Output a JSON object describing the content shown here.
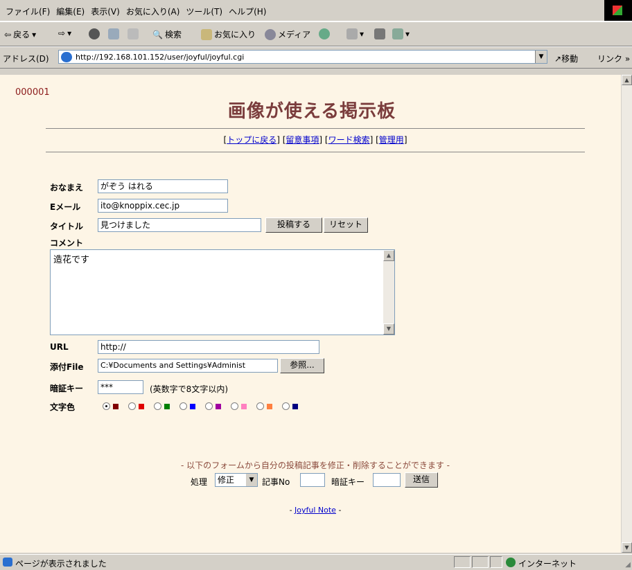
{
  "menu": [
    "ファイル(F)",
    "編集(E)",
    "表示(V)",
    "お気に入り(A)",
    "ツール(T)",
    "ヘルプ(H)"
  ],
  "toolbar": {
    "back": "戻る",
    "search": "検索",
    "favorites": "お気に入り",
    "media": "メディア"
  },
  "address": {
    "label": "アドレス(D)",
    "url": "http://192.168.101.152/user/joyful/joyful.cgi",
    "go": "移動",
    "links": "リンク »"
  },
  "page": {
    "counter": "000001",
    "title": "画像が使える掲示板",
    "nav": [
      {
        "label": "トップに戻る"
      },
      {
        "label": "留意事項"
      },
      {
        "label": "ワード検索"
      },
      {
        "label": "管理用"
      }
    ]
  },
  "form": {
    "name_label": "おなまえ",
    "name_value": "がぞう はれる",
    "email_label": "Eメール",
    "email_value": "ito@knoppix.cec.jp",
    "title_label": "タイトル",
    "title_value": "見つけました",
    "submit_label": "投稿する",
    "reset_label": "リセット",
    "comment_label": "コメント",
    "comment_value": "造花です",
    "url_label": "URL",
    "url_value": "http://",
    "file_label": "添付File",
    "file_value": "C:¥Documents and Settings¥Administ",
    "browse_label": "参照...",
    "key_label": "暗証キー",
    "key_value": "***",
    "key_note": "(英数字で8文字以内)",
    "color_label": "文字色",
    "colors": [
      "#800000",
      "#df0000",
      "#008000",
      "#0000ff",
      "#a000a0",
      "#ff80c0",
      "#ff8040",
      "#000080"
    ],
    "color_selected_index": 0
  },
  "edit": {
    "note": "- 以下のフォームから自分の投稿記事を修正・削除することができます -",
    "mode_label": "処理",
    "mode_value": "修正",
    "no_label": "記事No",
    "key_label": "暗証キー",
    "send_label": "送信"
  },
  "footer": {
    "link": "Joyful Note"
  },
  "status": {
    "text": "ページが表示されました",
    "zone": "インターネット"
  }
}
